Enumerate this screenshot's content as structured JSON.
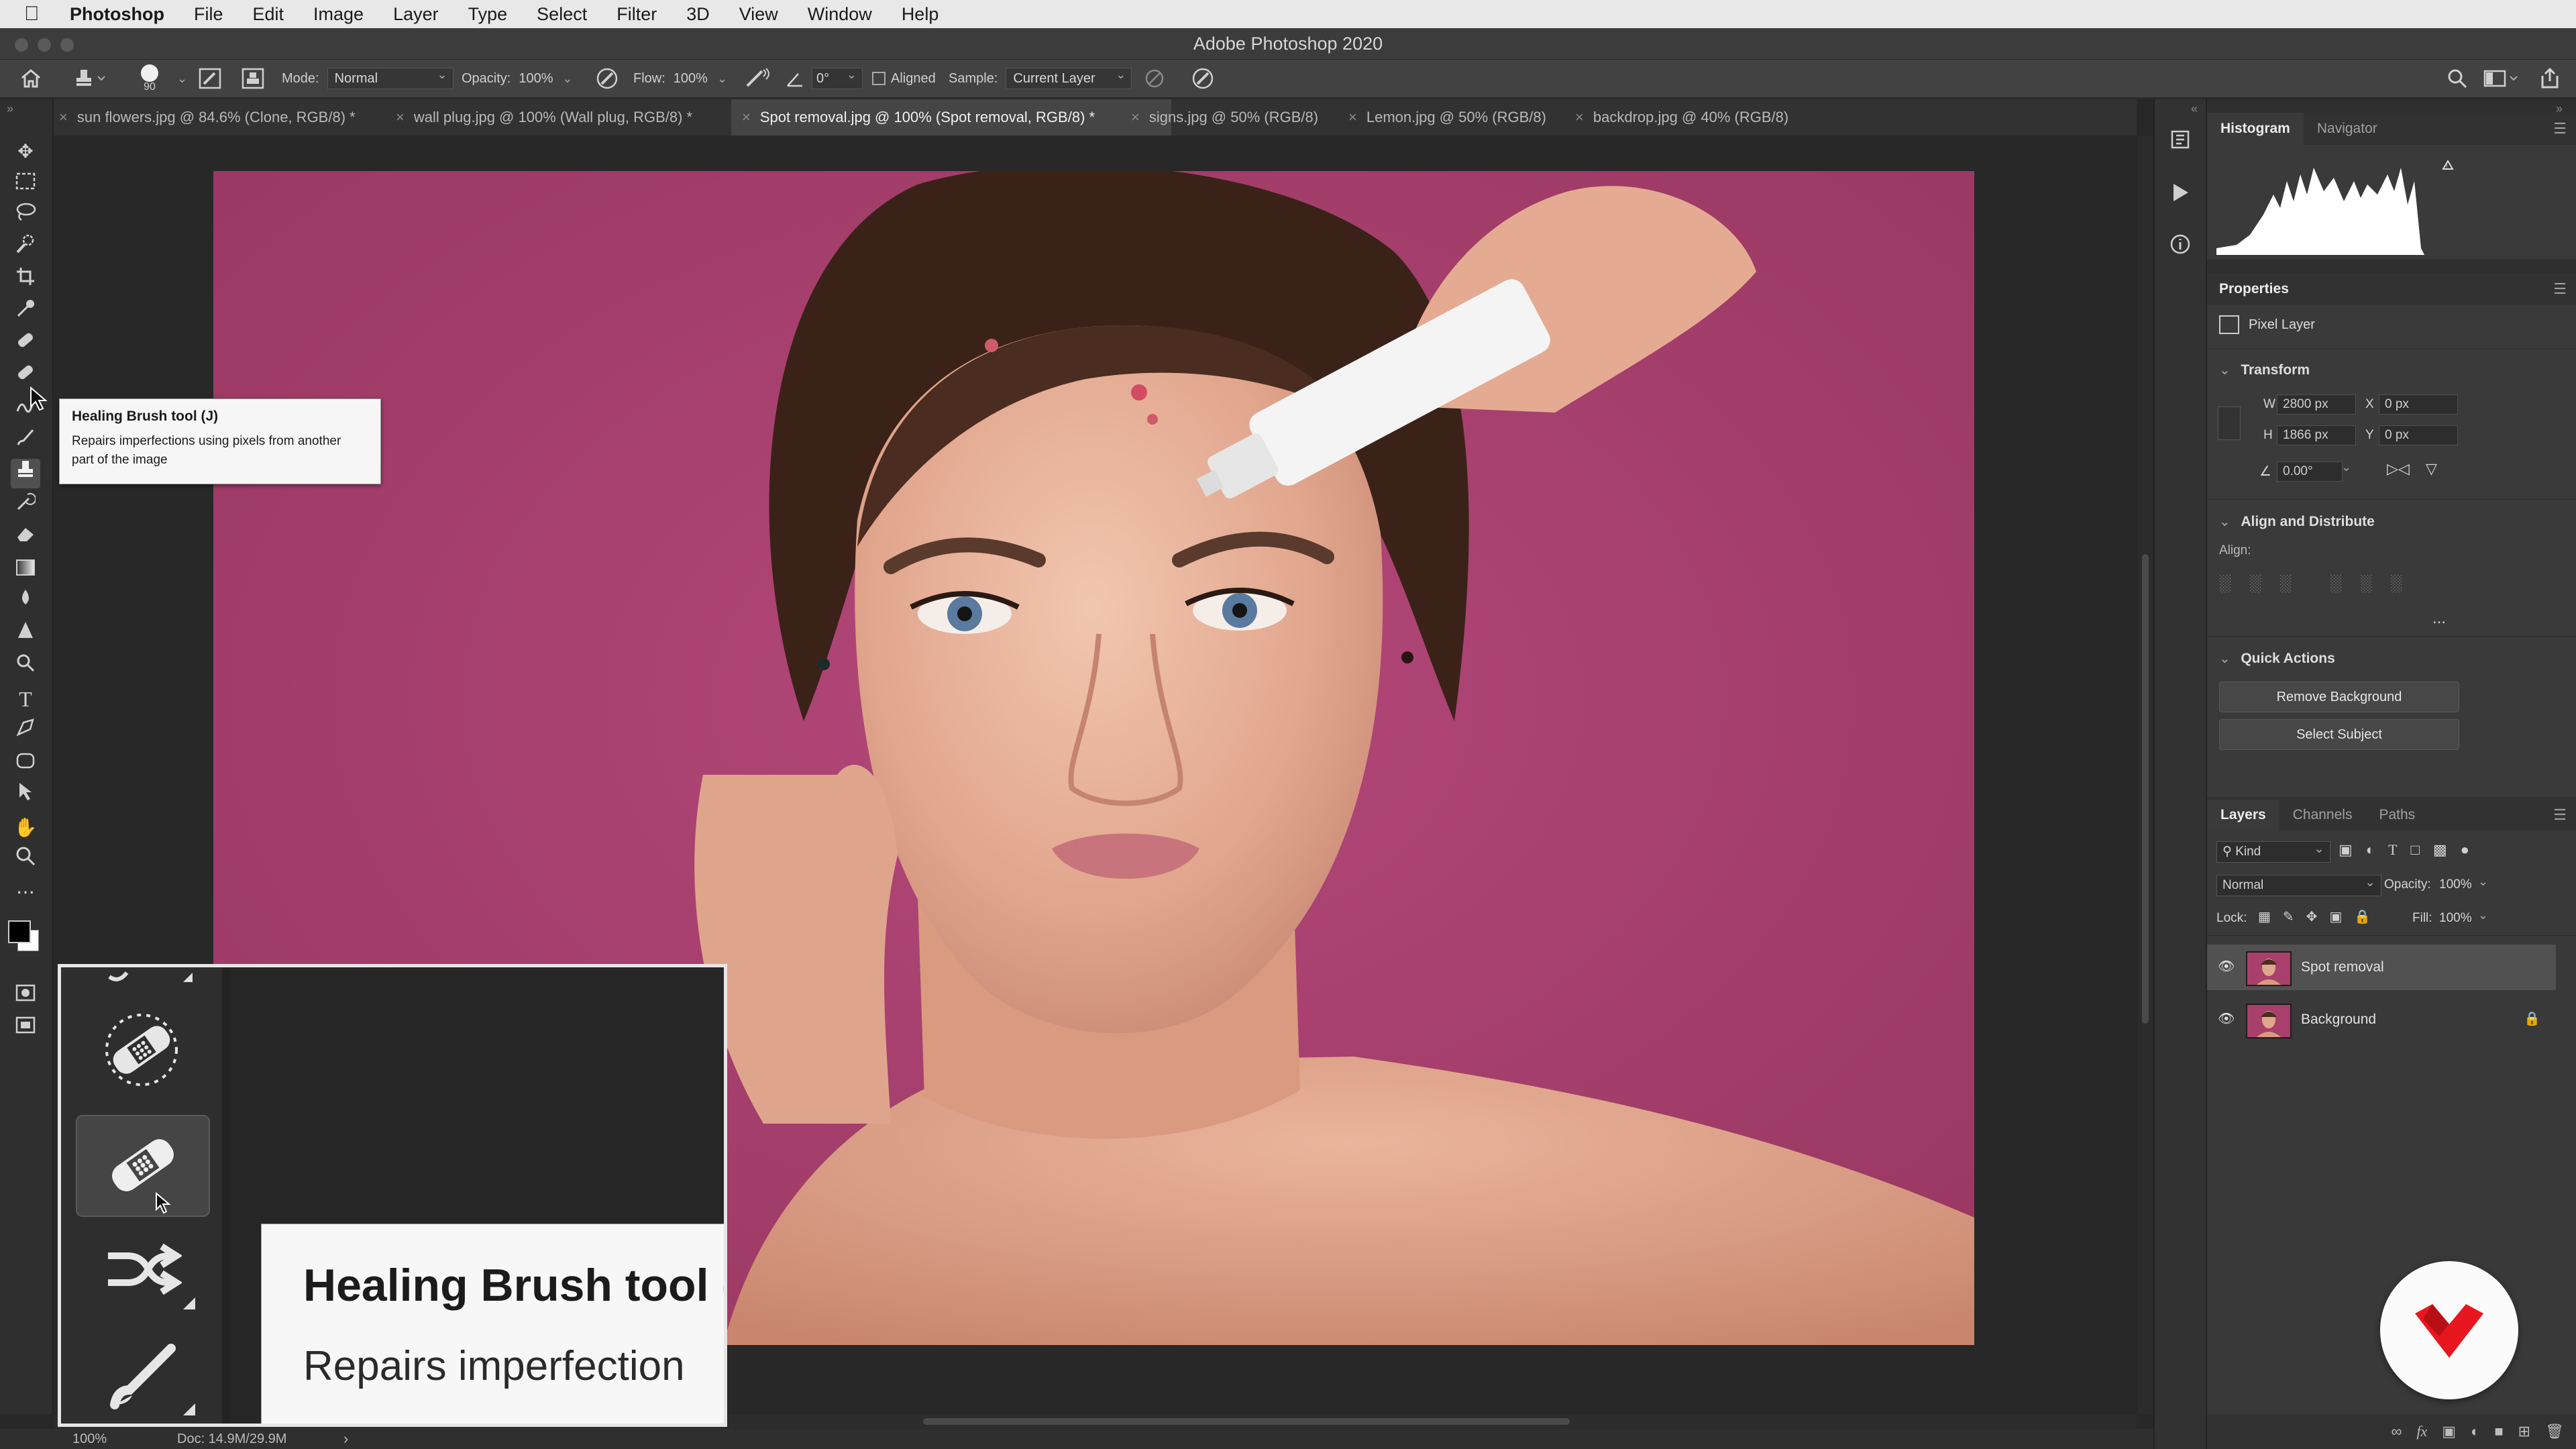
{
  "menubar": {
    "app_name": "Photoshop",
    "items": [
      "File",
      "Edit",
      "Image",
      "Layer",
      "Type",
      "Select",
      "Filter",
      "3D",
      "View",
      "Window",
      "Help"
    ]
  },
  "window_title": "Adobe Photoshop 2020",
  "options": {
    "brush_size": "90",
    "mode_label": "Mode:",
    "mode_value": "Normal",
    "opacity_label": "Opacity:",
    "opacity_value": "100%",
    "flow_label": "Flow:",
    "flow_value": "100%",
    "angle_value": "0°",
    "aligned_label": "Aligned",
    "sample_label": "Sample:",
    "sample_value": "Current Layer"
  },
  "tabs": [
    {
      "label": "sun flowers.jpg @ 84.6% (Clone, RGB/8) *",
      "active": false
    },
    {
      "label": "wall plug.jpg @ 100% (Wall plug, RGB/8) *",
      "active": false
    },
    {
      "label": "Spot removal.jpg @ 100% (Spot removal, RGB/8) *",
      "active": true
    },
    {
      "label": "signs.jpg @ 50% (RGB/8)",
      "active": false
    },
    {
      "label": "Lemon.jpg @ 50% (RGB/8)",
      "active": false
    },
    {
      "label": "backdrop.jpg @ 40% (RGB/8)",
      "active": false
    }
  ],
  "tooltip": {
    "title": "Healing Brush tool (J)",
    "description_line1": "Repairs imperfections using pixels from another",
    "description_line2": "part of the image"
  },
  "inset": {
    "title": "Healing Brush tool (",
    "description": "Repairs imperfection"
  },
  "status": {
    "zoom": "100%",
    "doc": "Doc: 14.9M/29.9M"
  },
  "panels": {
    "top_tabs": [
      "Histogram",
      "Navigator"
    ],
    "properties_title": "Properties",
    "layer_kind": "Pixel Layer",
    "transform_label": "Transform",
    "w_label": "W",
    "w_value": "2800 px",
    "h_label": "H",
    "h_value": "1866 px",
    "x_label": "X",
    "x_value": "0 px",
    "y_label": "Y",
    "y_value": "0 px",
    "angle_value": "0.00°",
    "align_section": "Align and Distribute",
    "align_label": "Align:",
    "more_label": "...",
    "quick_actions": "Quick Actions",
    "remove_bg": "Remove Background",
    "select_subject": "Select Subject",
    "layers_tabs": [
      "Layers",
      "Channels",
      "Paths"
    ],
    "kind_label": "Kind",
    "blend_mode": "Normal",
    "opacity_label": "Opacity:",
    "opacity_value": "100%",
    "lock_label": "Lock:",
    "fill_label": "Fill:",
    "fill_value": "100%",
    "layers": [
      {
        "name": "Spot removal",
        "selected": true,
        "locked": false
      },
      {
        "name": "Background",
        "selected": false,
        "locked": true
      }
    ]
  },
  "colors": {
    "backdrop": "#a8406b",
    "accent": "#e8161e"
  }
}
